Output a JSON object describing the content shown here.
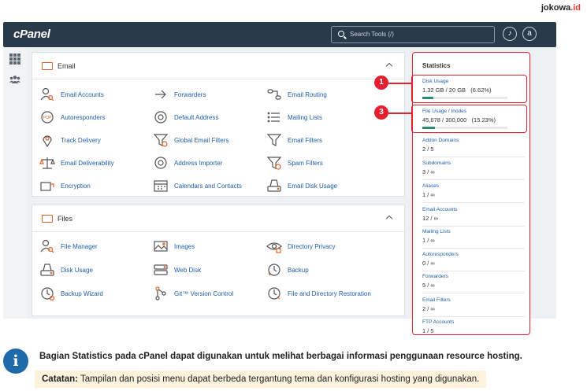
{
  "brand": {
    "name": "jokowa",
    "suffix": ".id"
  },
  "header": {
    "logo": "cPanel",
    "search_placeholder": "Search Tools (/)",
    "icons": [
      "bell-icon",
      "user-icon"
    ]
  },
  "sidebar": {
    "icons": [
      "apps-grid-icon",
      "users-icon"
    ]
  },
  "email_panel": {
    "title": "Email",
    "tools": [
      {
        "label": "Email Accounts",
        "icon": "user-search-icon"
      },
      {
        "label": "Forwarders",
        "icon": "forward-arrow-icon"
      },
      {
        "label": "Email Routing",
        "icon": "routing-icon"
      },
      {
        "label": "Autoresponders",
        "icon": "auto-icon"
      },
      {
        "label": "Default Address",
        "icon": "at-icon"
      },
      {
        "label": "Mailing Lists",
        "icon": "list-icon"
      },
      {
        "label": "Track Delivery",
        "icon": "location-pin-icon"
      },
      {
        "label": "Global Email Filters",
        "icon": "global-filter-icon"
      },
      {
        "label": "Email Filters",
        "icon": "filter-icon"
      },
      {
        "label": "Email Deliverability",
        "icon": "scale-icon"
      },
      {
        "label": "Address Importer",
        "icon": "at-icon"
      },
      {
        "label": "Spam Filters",
        "icon": "spam-filter-icon"
      },
      {
        "label": "Encryption",
        "icon": "key-icon"
      },
      {
        "label": "Calendars and Contacts",
        "icon": "calendar-icon"
      },
      {
        "label": "Email Disk Usage",
        "icon": "disk-icon"
      }
    ]
  },
  "files_panel": {
    "title": "Files",
    "tools": [
      {
        "label": "File Manager",
        "icon": "user-search-icon"
      },
      {
        "label": "Images",
        "icon": "image-icon"
      },
      {
        "label": "Directory Privacy",
        "icon": "eye-lock-icon"
      },
      {
        "label": "Disk Usage",
        "icon": "disk-icon"
      },
      {
        "label": "Web Disk",
        "icon": "web-disk-icon"
      },
      {
        "label": "Backup",
        "icon": "backup-icon"
      },
      {
        "label": "Backup Wizard",
        "icon": "backup-wizard-icon"
      },
      {
        "label": "Git™ Version Control",
        "icon": "git-icon"
      },
      {
        "label": "File and Directory Restoration",
        "icon": "restore-icon"
      }
    ]
  },
  "statistics": {
    "title": "Statistics",
    "items": [
      {
        "name": "Disk Usage",
        "value": "1.32 GB / 20 GB   (6.62%)",
        "percent": 6.62
      },
      {
        "name": "File Usage / Inodes",
        "value": "45,678 / 300,000   (15.23%)",
        "percent": 15.23
      },
      {
        "name": "Addon Domains",
        "value": "2 / 5"
      },
      {
        "name": "Subdomains",
        "value": "3 / ∞"
      },
      {
        "name": "Aliases",
        "value": "1 / ∞"
      },
      {
        "name": "Email Accounts",
        "value": "12 / ∞"
      },
      {
        "name": "Mailing Lists",
        "value": "1 / ∞"
      },
      {
        "name": "Autoresponders",
        "value": "0 / ∞"
      },
      {
        "name": "Forwarders",
        "value": "5 / ∞"
      },
      {
        "name": "Email Filters",
        "value": "2 / ∞"
      },
      {
        "name": "FTP Accounts",
        "value": "1 / 5"
      }
    ],
    "badges": [
      "1",
      "3"
    ]
  },
  "footer": {
    "info": "Bagian Statistics pada cPanel dapat digunakan untuk melihat berbagai informasi penggunaan resource hosting.",
    "note_label": "Catatan:",
    "note_text": " Tampilan dan posisi menu dapat berbeda tergantung tema dan konfigurasi hosting yang digunakan."
  },
  "colors": {
    "accent": "#e0632b",
    "link": "#1f5fa8",
    "header": "#293a4a",
    "highlight": "#e5202e"
  }
}
